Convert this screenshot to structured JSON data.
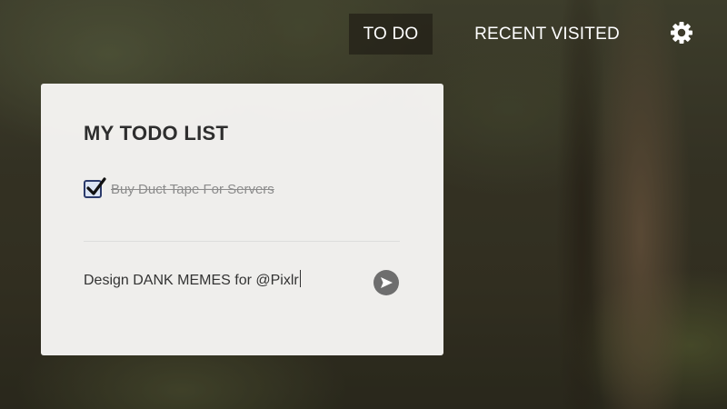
{
  "nav": {
    "tabs": [
      {
        "label": "TO DO",
        "active": true
      },
      {
        "label": "RECENT VISITED",
        "active": false
      }
    ],
    "settings_icon": "gear-icon"
  },
  "todo_card": {
    "title": "MY TODO LIST",
    "items": [
      {
        "text": "Buy Duct Tape For Servers",
        "checked": true
      }
    ],
    "new_item": {
      "value": "Design DANK MEMES for @Pixlr",
      "submit_icon": "send-arrow-icon"
    }
  },
  "colors": {
    "nav_text": "#ffffff",
    "card_background": "#f6f5f3",
    "title_text": "#2e2e2e",
    "completed_text": "#8c8c8c",
    "checkbox_border": "#2b3a6b",
    "submit_button": "#6e6e6e"
  }
}
